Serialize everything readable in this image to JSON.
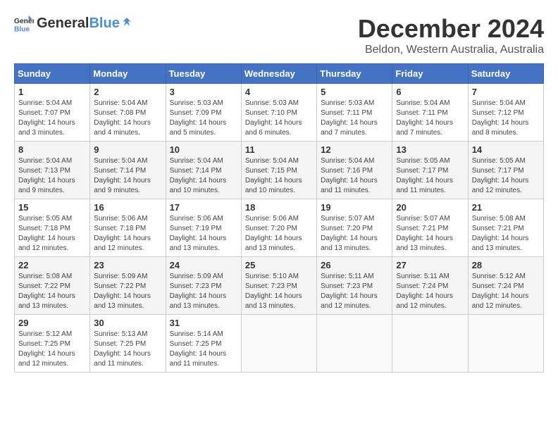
{
  "header": {
    "logo_general": "General",
    "logo_blue": "Blue",
    "month_title": "December 2024",
    "location": "Beldon, Western Australia, Australia"
  },
  "calendar": {
    "days_of_week": [
      "Sunday",
      "Monday",
      "Tuesday",
      "Wednesday",
      "Thursday",
      "Friday",
      "Saturday"
    ],
    "weeks": [
      [
        {
          "day": "1",
          "sunrise": "5:04 AM",
          "sunset": "7:07 PM",
          "daylight": "14 hours and 3 minutes."
        },
        {
          "day": "2",
          "sunrise": "5:04 AM",
          "sunset": "7:08 PM",
          "daylight": "14 hours and 4 minutes."
        },
        {
          "day": "3",
          "sunrise": "5:03 AM",
          "sunset": "7:09 PM",
          "daylight": "14 hours and 5 minutes."
        },
        {
          "day": "4",
          "sunrise": "5:03 AM",
          "sunset": "7:10 PM",
          "daylight": "14 hours and 6 minutes."
        },
        {
          "day": "5",
          "sunrise": "5:03 AM",
          "sunset": "7:11 PM",
          "daylight": "14 hours and 7 minutes."
        },
        {
          "day": "6",
          "sunrise": "5:04 AM",
          "sunset": "7:11 PM",
          "daylight": "14 hours and 7 minutes."
        },
        {
          "day": "7",
          "sunrise": "5:04 AM",
          "sunset": "7:12 PM",
          "daylight": "14 hours and 8 minutes."
        }
      ],
      [
        {
          "day": "8",
          "sunrise": "5:04 AM",
          "sunset": "7:13 PM",
          "daylight": "14 hours and 9 minutes."
        },
        {
          "day": "9",
          "sunrise": "5:04 AM",
          "sunset": "7:14 PM",
          "daylight": "14 hours and 9 minutes."
        },
        {
          "day": "10",
          "sunrise": "5:04 AM",
          "sunset": "7:14 PM",
          "daylight": "14 hours and 10 minutes."
        },
        {
          "day": "11",
          "sunrise": "5:04 AM",
          "sunset": "7:15 PM",
          "daylight": "14 hours and 10 minutes."
        },
        {
          "day": "12",
          "sunrise": "5:04 AM",
          "sunset": "7:16 PM",
          "daylight": "14 hours and 11 minutes."
        },
        {
          "day": "13",
          "sunrise": "5:05 AM",
          "sunset": "7:17 PM",
          "daylight": "14 hours and 11 minutes."
        },
        {
          "day": "14",
          "sunrise": "5:05 AM",
          "sunset": "7:17 PM",
          "daylight": "14 hours and 12 minutes."
        }
      ],
      [
        {
          "day": "15",
          "sunrise": "5:05 AM",
          "sunset": "7:18 PM",
          "daylight": "14 hours and 12 minutes."
        },
        {
          "day": "16",
          "sunrise": "5:06 AM",
          "sunset": "7:18 PM",
          "daylight": "14 hours and 12 minutes."
        },
        {
          "day": "17",
          "sunrise": "5:06 AM",
          "sunset": "7:19 PM",
          "daylight": "14 hours and 13 minutes."
        },
        {
          "day": "18",
          "sunrise": "5:06 AM",
          "sunset": "7:20 PM",
          "daylight": "14 hours and 13 minutes."
        },
        {
          "day": "19",
          "sunrise": "5:07 AM",
          "sunset": "7:20 PM",
          "daylight": "14 hours and 13 minutes."
        },
        {
          "day": "20",
          "sunrise": "5:07 AM",
          "sunset": "7:21 PM",
          "daylight": "14 hours and 13 minutes."
        },
        {
          "day": "21",
          "sunrise": "5:08 AM",
          "sunset": "7:21 PM",
          "daylight": "14 hours and 13 minutes."
        }
      ],
      [
        {
          "day": "22",
          "sunrise": "5:08 AM",
          "sunset": "7:22 PM",
          "daylight": "14 hours and 13 minutes."
        },
        {
          "day": "23",
          "sunrise": "5:09 AM",
          "sunset": "7:22 PM",
          "daylight": "14 hours and 13 minutes."
        },
        {
          "day": "24",
          "sunrise": "5:09 AM",
          "sunset": "7:23 PM",
          "daylight": "14 hours and 13 minutes."
        },
        {
          "day": "25",
          "sunrise": "5:10 AM",
          "sunset": "7:23 PM",
          "daylight": "14 hours and 13 minutes."
        },
        {
          "day": "26",
          "sunrise": "5:11 AM",
          "sunset": "7:23 PM",
          "daylight": "14 hours and 12 minutes."
        },
        {
          "day": "27",
          "sunrise": "5:11 AM",
          "sunset": "7:24 PM",
          "daylight": "14 hours and 12 minutes."
        },
        {
          "day": "28",
          "sunrise": "5:12 AM",
          "sunset": "7:24 PM",
          "daylight": "14 hours and 12 minutes."
        }
      ],
      [
        {
          "day": "29",
          "sunrise": "5:12 AM",
          "sunset": "7:25 PM",
          "daylight": "14 hours and 12 minutes."
        },
        {
          "day": "30",
          "sunrise": "5:13 AM",
          "sunset": "7:25 PM",
          "daylight": "14 hours and 11 minutes."
        },
        {
          "day": "31",
          "sunrise": "5:14 AM",
          "sunset": "7:25 PM",
          "daylight": "14 hours and 11 minutes."
        },
        null,
        null,
        null,
        null
      ]
    ],
    "labels": {
      "sunrise": "Sunrise:",
      "sunset": "Sunset:",
      "daylight": "Daylight:"
    }
  }
}
